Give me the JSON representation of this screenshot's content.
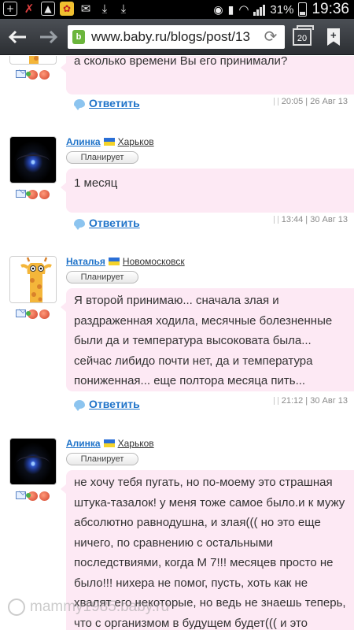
{
  "status_bar": {
    "battery": "31%",
    "time": "19:36"
  },
  "browser": {
    "url": "www.baby.ru/blogs/post/13",
    "tabs_count": "20",
    "site_icon_letter": "b"
  },
  "comments": [
    {
      "author": "",
      "city": "",
      "status": "",
      "text": "а сколько времени Вы его принимали?",
      "reply": "Ответить",
      "timestamp": "20:05 | 26 Авг 13"
    },
    {
      "author": "Алинка",
      "city": "Харьков",
      "status": "Планирует",
      "text": "1 месяц",
      "reply": "Ответить",
      "timestamp": "13:44 | 30 Авг 13"
    },
    {
      "author": "Наталья",
      "city": "Новомосковск",
      "status": "Планирует",
      "text": "Я второй принимаю... сначала злая и раздраженная ходила, месячные болезненные были да и температура высоковата была... сейчас либидо почти нет, да и температура пониженная... еще полтора месяца пить...",
      "reply": "Ответить",
      "timestamp": "21:12 | 30 Авг 13"
    },
    {
      "author": "Алинка",
      "city": "Харьков",
      "status": "Планирует",
      "text": "не хочу тебя пугать, но по-моему это страшная штука-тазалок! у меня тоже самое было.и к мужу абсолютно равнодушна, и злая((( но это еще ничего, по сравнению с остальными последствиями, когда М 7!!! месяцев просто не было!!! нихера не помог, пусть, хоть как не хвалят его некоторые, но ведь не знаешь теперь, что с организмом в будущем будет((( и это печалит(((",
      "reply": "",
      "timestamp": ""
    }
  ],
  "watermark": "mammy1985.baby.ru",
  "colors": {
    "link": "#1f73c9",
    "bubble": "#fde9f4",
    "toolbar": "#3a3e43"
  }
}
